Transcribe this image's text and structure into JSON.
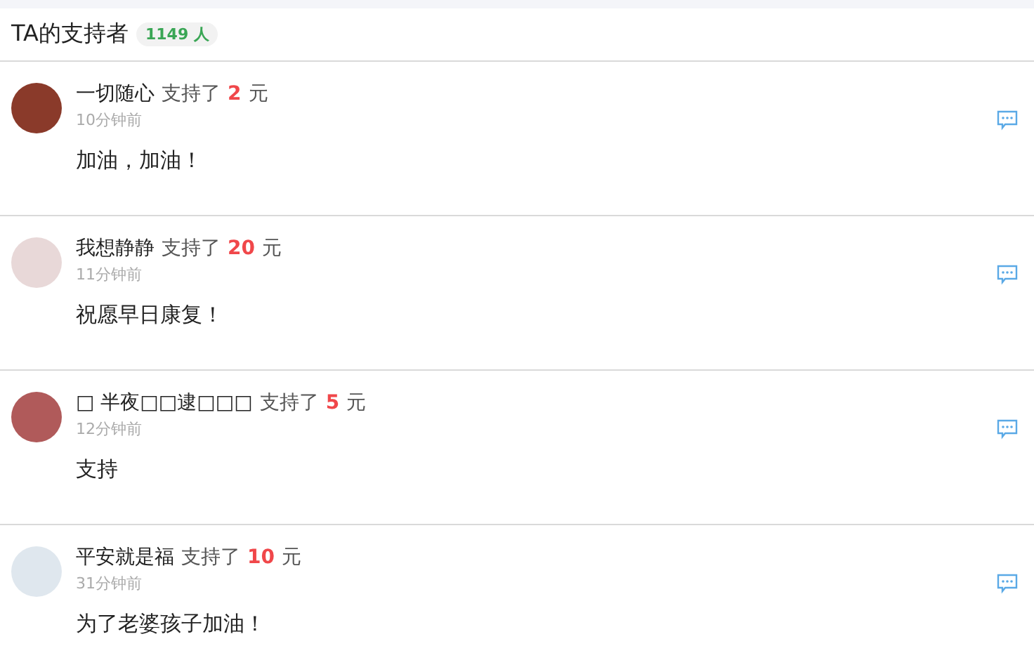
{
  "header": {
    "title": "TA的支持者",
    "count": "1149 人"
  },
  "supporters": [
    {
      "name": "一切随心",
      "action": "支持了",
      "amount": "2",
      "unit": "元",
      "time": "10分钟前",
      "message": "加油，加油！"
    },
    {
      "name": "我想静静",
      "action": "支持了",
      "amount": "20",
      "unit": "元",
      "time": "11分钟前",
      "message": "祝愿早日康复！"
    },
    {
      "name": "□ 半夜□□逮□□□",
      "action": "支持了",
      "amount": "5",
      "unit": "元",
      "time": "12分钟前",
      "message": "支持"
    },
    {
      "name": "平安就是福",
      "action": "支持了",
      "amount": "10",
      "unit": "元",
      "time": "31分钟前",
      "message": "为了老婆孩子加油！"
    }
  ]
}
